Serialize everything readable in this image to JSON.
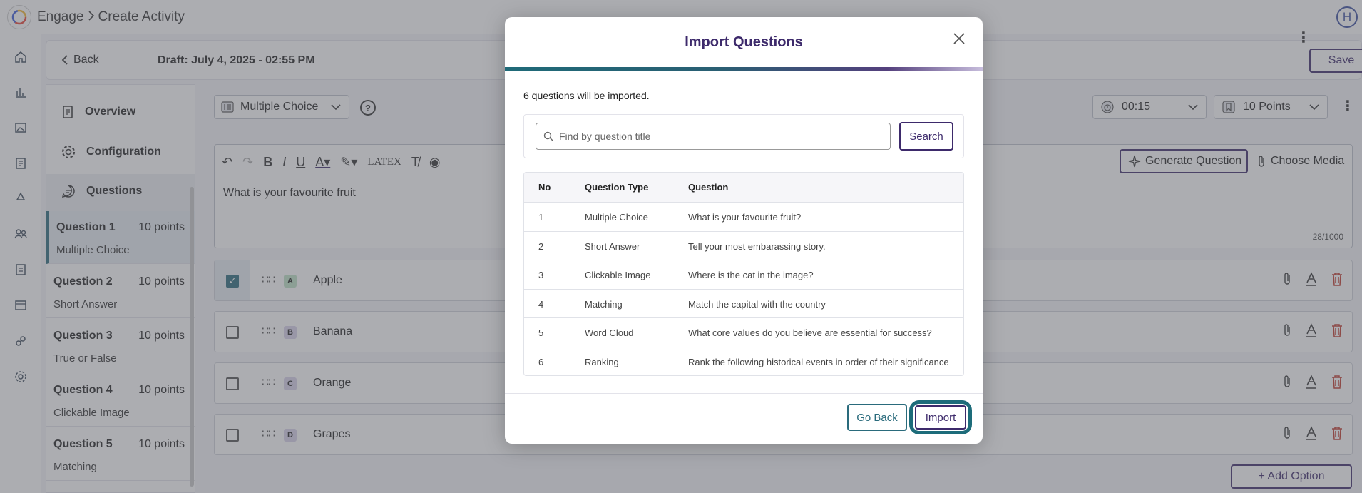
{
  "app": {
    "breadcrumb": [
      "Engage",
      "Create Activity"
    ],
    "avatar_initial": "H"
  },
  "header": {
    "back_label": "Back",
    "draft_label": "Draft: July 4, 2025 - 02:55 PM",
    "save_label": "Save"
  },
  "sections": [
    {
      "label": "Overview",
      "icon": "document-icon"
    },
    {
      "label": "Configuration",
      "icon": "gear-icon"
    },
    {
      "label": "Questions",
      "icon": "chat-icon"
    }
  ],
  "questions": [
    {
      "title": "Question 1",
      "points": "10 points",
      "type": "Multiple Choice",
      "active": true
    },
    {
      "title": "Question 2",
      "points": "10 points",
      "type": "Short Answer"
    },
    {
      "title": "Question 3",
      "points": "10 points",
      "type": "True or False"
    },
    {
      "title": "Question 4",
      "points": "10 points",
      "type": "Clickable Image"
    },
    {
      "title": "Question 5",
      "points": "10 points",
      "type": "Matching"
    }
  ],
  "editor": {
    "question_type": "Multiple Choice",
    "timer": "00:15",
    "points": "10 Points",
    "text": "What is your favourite fruit",
    "counter": "28/1000",
    "generate_label": "Generate Question",
    "media_label": "Choose Media",
    "latex_label": "LATEX"
  },
  "options": [
    {
      "letter": "A",
      "text": "Apple",
      "checked": true,
      "letter_color": "#bfe3c6"
    },
    {
      "letter": "B",
      "text": "Banana",
      "checked": false,
      "letter_color": "#d9d3ea"
    },
    {
      "letter": "C",
      "text": "Orange",
      "checked": false,
      "letter_color": "#d9d3ea"
    },
    {
      "letter": "D",
      "text": "Grapes",
      "checked": false,
      "letter_color": "#d9d3ea"
    }
  ],
  "add_option_label": "+ Add Option",
  "modal": {
    "title": "Import Questions",
    "count_text": "6 questions will be imported.",
    "search_placeholder": "Find by question title",
    "search_label": "Search",
    "columns": [
      "No",
      "Question Type",
      "Question"
    ],
    "rows": [
      {
        "no": "1",
        "type": "Multiple Choice",
        "question": "What is your favourite fruit?"
      },
      {
        "no": "2",
        "type": "Short Answer",
        "question": "Tell your most embarassing story."
      },
      {
        "no": "3",
        "type": "Clickable Image",
        "question": "Where is the cat in the image?"
      },
      {
        "no": "4",
        "type": "Matching",
        "question": "Match the capital with the country"
      },
      {
        "no": "5",
        "type": "Word Cloud",
        "question": "What core values do you believe are essential for success?"
      },
      {
        "no": "6",
        "type": "Ranking",
        "question": "Rank the following historical events in order of their significance"
      }
    ],
    "go_back_label": "Go Back",
    "import_label": "Import"
  },
  "colors": {
    "brand_purple": "#3d2a6b",
    "brand_teal": "#2a6b7c",
    "delete_red": "#c0392b"
  }
}
